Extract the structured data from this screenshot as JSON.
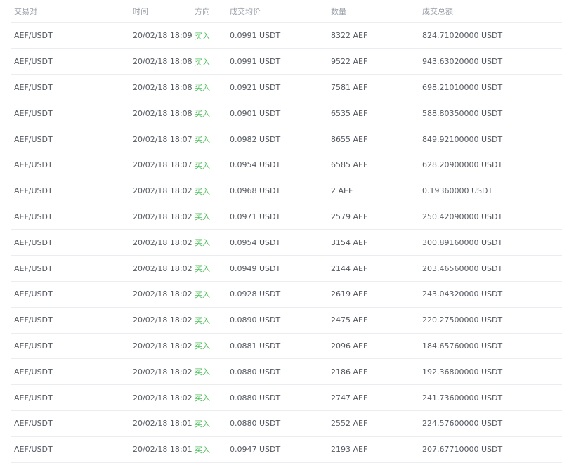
{
  "headers": {
    "pair": "交易对",
    "time": "时间",
    "side": "方向",
    "price": "成交均价",
    "qty": "数量",
    "total": "成交总额"
  },
  "colors": {
    "buy": "#4fbf5b",
    "header_text": "#9aa0a8",
    "body_text": "#555a61",
    "divider": "#ebedf0"
  },
  "rows": [
    {
      "pair": "AEF/USDT",
      "time": "20/02/18 18:09",
      "side": "买入",
      "price": "0.0991 USDT",
      "qty": "8322 AEF",
      "total": "824.71020000 USDT"
    },
    {
      "pair": "AEF/USDT",
      "time": "20/02/18 18:08",
      "side": "买入",
      "price": "0.0991 USDT",
      "qty": "9522 AEF",
      "total": "943.63020000 USDT"
    },
    {
      "pair": "AEF/USDT",
      "time": "20/02/18 18:08",
      "side": "买入",
      "price": "0.0921 USDT",
      "qty": "7581 AEF",
      "total": "698.21010000 USDT"
    },
    {
      "pair": "AEF/USDT",
      "time": "20/02/18 18:08",
      "side": "买入",
      "price": "0.0901 USDT",
      "qty": "6535 AEF",
      "total": "588.80350000 USDT"
    },
    {
      "pair": "AEF/USDT",
      "time": "20/02/18 18:07",
      "side": "买入",
      "price": "0.0982 USDT",
      "qty": "8655 AEF",
      "total": "849.92100000 USDT"
    },
    {
      "pair": "AEF/USDT",
      "time": "20/02/18 18:07",
      "side": "买入",
      "price": "0.0954 USDT",
      "qty": "6585 AEF",
      "total": "628.20900000 USDT"
    },
    {
      "pair": "AEF/USDT",
      "time": "20/02/18 18:02",
      "side": "买入",
      "price": "0.0968 USDT",
      "qty": "2 AEF",
      "total": "0.19360000 USDT"
    },
    {
      "pair": "AEF/USDT",
      "time": "20/02/18 18:02",
      "side": "买入",
      "price": "0.0971 USDT",
      "qty": "2579 AEF",
      "total": "250.42090000 USDT"
    },
    {
      "pair": "AEF/USDT",
      "time": "20/02/18 18:02",
      "side": "买入",
      "price": "0.0954 USDT",
      "qty": "3154 AEF",
      "total": "300.89160000 USDT"
    },
    {
      "pair": "AEF/USDT",
      "time": "20/02/18 18:02",
      "side": "买入",
      "price": "0.0949 USDT",
      "qty": "2144 AEF",
      "total": "203.46560000 USDT"
    },
    {
      "pair": "AEF/USDT",
      "time": "20/02/18 18:02",
      "side": "买入",
      "price": "0.0928 USDT",
      "qty": "2619 AEF",
      "total": "243.04320000 USDT"
    },
    {
      "pair": "AEF/USDT",
      "time": "20/02/18 18:02",
      "side": "买入",
      "price": "0.0890 USDT",
      "qty": "2475 AEF",
      "total": "220.27500000 USDT"
    },
    {
      "pair": "AEF/USDT",
      "time": "20/02/18 18:02",
      "side": "买入",
      "price": "0.0881 USDT",
      "qty": "2096 AEF",
      "total": "184.65760000 USDT"
    },
    {
      "pair": "AEF/USDT",
      "time": "20/02/18 18:02",
      "side": "买入",
      "price": "0.0880 USDT",
      "qty": "2186 AEF",
      "total": "192.36800000 USDT"
    },
    {
      "pair": "AEF/USDT",
      "time": "20/02/18 18:02",
      "side": "买入",
      "price": "0.0880 USDT",
      "qty": "2747 AEF",
      "total": "241.73600000 USDT"
    },
    {
      "pair": "AEF/USDT",
      "time": "20/02/18 18:01",
      "side": "买入",
      "price": "0.0880 USDT",
      "qty": "2552 AEF",
      "total": "224.57600000 USDT"
    },
    {
      "pair": "AEF/USDT",
      "time": "20/02/18 18:01",
      "side": "买入",
      "price": "0.0947 USDT",
      "qty": "2193 AEF",
      "total": "207.67710000 USDT"
    }
  ]
}
